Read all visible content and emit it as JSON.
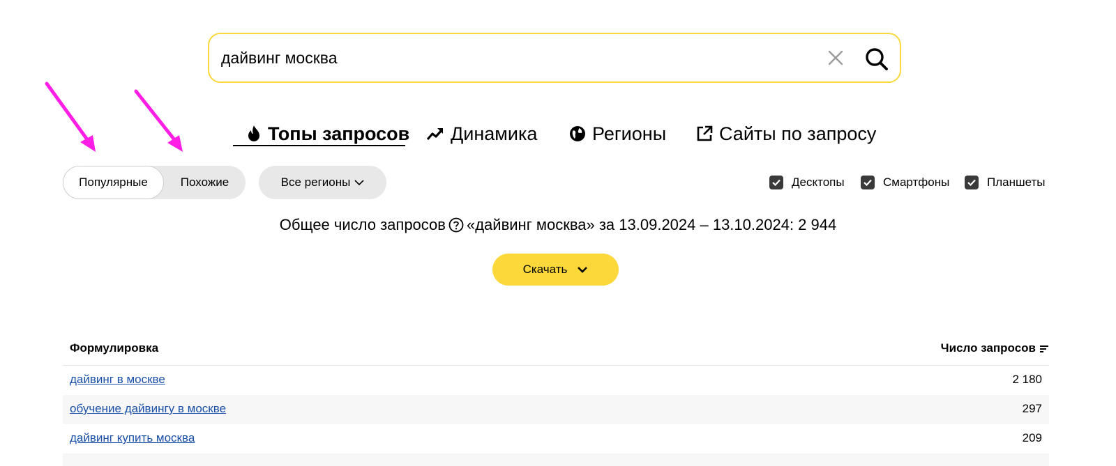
{
  "search": {
    "value": "дайвинг москва"
  },
  "tabs": [
    {
      "label": "Топы запросов",
      "icon": "fire-icon",
      "active": true
    },
    {
      "label": "Динамика",
      "icon": "trend-up-icon"
    },
    {
      "label": "Регионы",
      "icon": "globe-icon"
    },
    {
      "label": "Сайты по запросу",
      "icon": "external-link-icon"
    }
  ],
  "filters": {
    "toggle": {
      "popular": "Популярные",
      "similar": "Похожие",
      "selected": "Популярные"
    },
    "region": "Все регионы",
    "devices": [
      {
        "label": "Десктопы",
        "checked": true
      },
      {
        "label": "Смартфоны",
        "checked": true
      },
      {
        "label": "Планшеты",
        "checked": true
      }
    ]
  },
  "total": {
    "prefix": "Общее число запросов",
    "query_text": "«дайвинг москва» за 13.09.2024 – 13.10.2024: 2 944"
  },
  "download_label": "Скачать",
  "table": {
    "col_phrase": "Формулировка",
    "col_count": "Число запросов",
    "rows": [
      {
        "phrase": "дайвинг в москве",
        "count": "2 180"
      },
      {
        "phrase": "обучение дайвингу в москве",
        "count": "297"
      },
      {
        "phrase": "дайвинг купить москва",
        "count": "209"
      }
    ]
  },
  "colors": {
    "accent_yellow": "#fdd83a",
    "link_blue": "#1a4fa8",
    "annotation_arrow": "#ff1ee6"
  }
}
